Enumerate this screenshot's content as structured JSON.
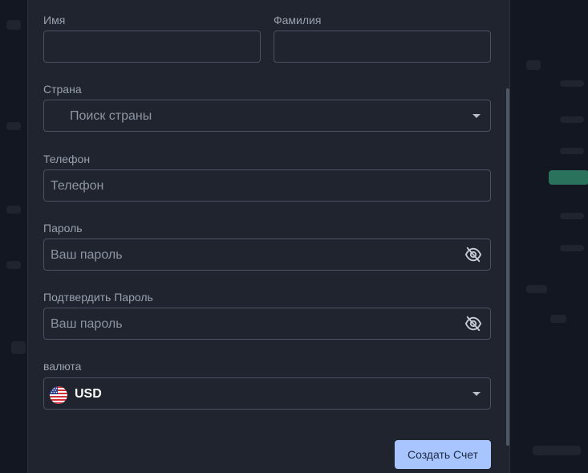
{
  "form": {
    "first_name": {
      "label": "Имя",
      "value": "",
      "placeholder": ""
    },
    "last_name": {
      "label": "Фамилия",
      "value": "",
      "placeholder": ""
    },
    "country": {
      "label": "Страна",
      "placeholder": "Поиск страны"
    },
    "phone": {
      "label": "Телефон",
      "placeholder": "Телефон"
    },
    "password": {
      "label": "Пароль",
      "placeholder": "Ваш пароль"
    },
    "confirm_password": {
      "label": "Подтвердить Пароль",
      "placeholder": "Ваш пароль"
    },
    "currency": {
      "label": "валюта",
      "value": "USD"
    }
  },
  "actions": {
    "submit_label": "Создать Счет"
  },
  "icons": {
    "password_toggle": "eye-off-icon",
    "confirm_password_toggle": "eye-off-icon",
    "country_dropdown": "chevron-down-icon",
    "currency_dropdown": "chevron-down-icon",
    "currency_flag": "us-flag-icon"
  },
  "colors": {
    "modal_bg": "#1f242f",
    "border": "#4a5160",
    "label": "#9aa1ad",
    "placeholder": "#8e95a1",
    "button": "#a9c5ff",
    "button_text": "#1c2a45"
  }
}
